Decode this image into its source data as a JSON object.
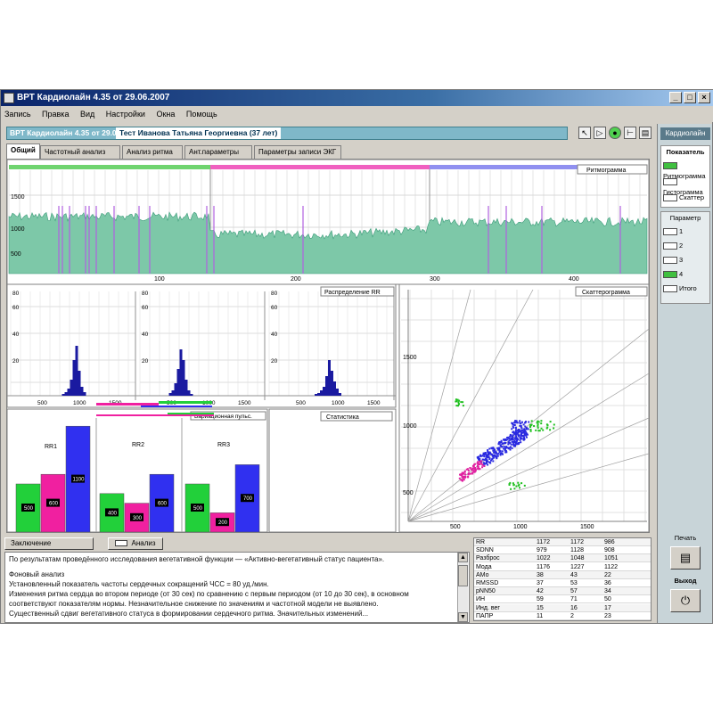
{
  "window": {
    "title": "ВРТ Кардиолайн 4.35 от 29.06.2007",
    "controls": [
      "_",
      "□",
      "×"
    ]
  },
  "menu": [
    "Запись",
    "Правка",
    "Вид",
    "Настройки",
    "Окна",
    "Помощь"
  ],
  "header": {
    "study_label": "ВРТ Кардиолайн 4.35 от 29.06",
    "patient_label": "Тест Иванова Татьяна Георгиевна (37 лет)"
  },
  "tools": [
    "arrow-icon",
    "cursor-icon",
    "zoom-icon",
    "ruler-icon",
    "print-icon"
  ],
  "tabs": [
    "Общий",
    "Частотный анализ",
    "Анализ ритма",
    "Ант.параметры",
    "Параметры записи ЭКГ"
  ],
  "active_tab": 0,
  "rhythmogram": {
    "legend": "Ритмограмма",
    "y_ticks": [
      "1500",
      "1000",
      "500"
    ],
    "x_ticks": [
      "100",
      "200",
      "300",
      "400"
    ],
    "segment_colors": [
      "#6fd46f",
      "#f060c0",
      "#9090f0"
    ]
  },
  "histograms": {
    "legend": "Распределение RR",
    "y_ticks": [
      "80",
      "60",
      "40",
      "20"
    ],
    "x_ticks": [
      "500",
      "1000",
      "1500"
    ]
  },
  "bar_groups": {
    "legend": "Вариационная пульс.",
    "groups": [
      {
        "label": "RR1",
        "values": [
          "500",
          "600",
          "1100"
        ]
      },
      {
        "label": "RR2",
        "values": [
          "400",
          "300",
          "600"
        ]
      },
      {
        "label": "RR3",
        "values": [
          "500",
          "200",
          "700"
        ]
      }
    ],
    "colors": [
      "#22d03a",
      "#f020a0",
      "#3030f0"
    ]
  },
  "empty_panel": {
    "legend": "Статистика"
  },
  "scatter": {
    "legend": "Скаттерограмма",
    "y_ticks": [
      "1500",
      "1000",
      "500"
    ],
    "x_ticks": [
      "500",
      "1000",
      "1500"
    ]
  },
  "right_panel": {
    "top_button": "Кардиолайн",
    "group1_title": "Показатель",
    "group1_items": [
      "Ритмограмма",
      "Гистограмма",
      "Скаттер"
    ],
    "group2_title": "Параметр",
    "group2_items": [
      "1",
      "2",
      "3",
      "4",
      "Итого"
    ],
    "print_label": "Печать",
    "exit_label": "Выход"
  },
  "bottom": {
    "summary_label": "Заключение",
    "mode_label": "Анализ",
    "text_lines": [
      "По результатам проведённого исследования вегетативной функции — «Активно-вегетативный статус пациента».",
      "",
      "Фоновый анализ",
      "Установленный показатель частоты сердечных сокращений ЧСС = 80 уд./мин.",
      "Изменения ритма сердца во втором периоде (от 30 сек) по сравнению с первым периодом (от 10 до 30 сек), в основном",
      "соответствуют показателям нормы. Незначительное снижение по значениям и частотной модели не выявлено.",
      "Существенный сдвиг вегетативного статуса в формировании сердечного ритма. Значительных изменений..."
    ]
  },
  "stats_table": {
    "rows": [
      [
        "RR",
        "1172",
        "1172",
        "986"
      ],
      [
        "SDNN",
        "979",
        "1128",
        "908"
      ],
      [
        "Разброс",
        "1022",
        "1048",
        "1051"
      ],
      [
        "Мода",
        "1176",
        "1227",
        "1122"
      ],
      [
        "АМо",
        "38",
        "43",
        "22"
      ],
      [
        "RMSSD",
        "37",
        "53",
        "36"
      ],
      [
        "pNN50",
        "42",
        "57",
        "34"
      ],
      [
        "ИН",
        "59",
        "71",
        "50"
      ],
      [
        "Инд. вег",
        "15",
        "16",
        "17"
      ],
      [
        "ПАПР",
        "11",
        "2",
        "23"
      ]
    ]
  },
  "colors": {
    "rhythm_fill": "#7dc8a8",
    "rhythm_line": "#3a9a78",
    "artifact": "#b060e0",
    "hist_bar": "#1a1aa0",
    "scatter_blue": "#2a2ae0",
    "scatter_green": "#20c020",
    "scatter_pink": "#e020a0",
    "panel_bg": "#d4d0c8",
    "title_bg": "#0a246a"
  }
}
